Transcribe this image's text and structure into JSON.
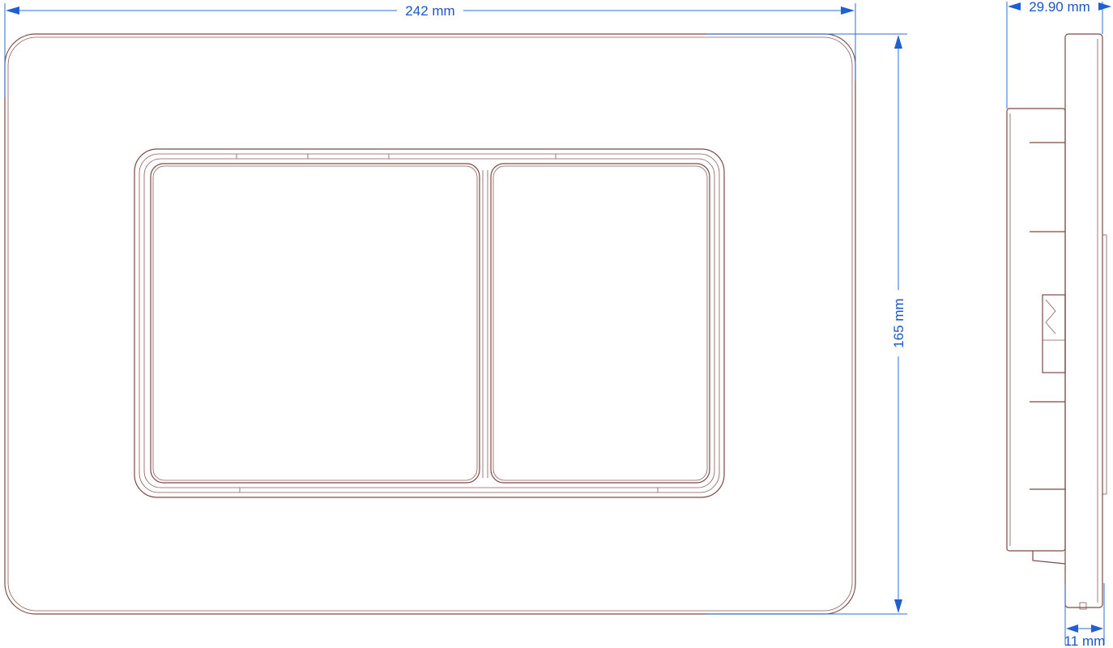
{
  "dimensions": {
    "width": "242 mm",
    "height": "165 mm",
    "total_depth": "29.90 mm",
    "plate_depth": "11 mm"
  },
  "colors": {
    "outline": "#7a4a45",
    "dimension": "#1a56c4"
  }
}
